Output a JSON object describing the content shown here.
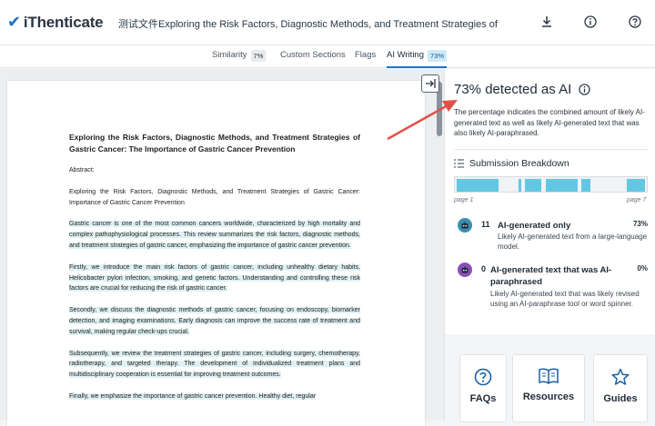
{
  "header": {
    "logo_text": "iThenticate",
    "doc_title": "测试文件Exploring the Risk Factors, Diagnostic Methods, and Treatment Strategies of Gastric Cancer The I",
    "icons": [
      "download-icon",
      "info-icon",
      "help-icon"
    ]
  },
  "tabs": [
    {
      "label": "Similarity",
      "badge": "7%"
    },
    {
      "label": "Custom Sections",
      "badge": ""
    },
    {
      "label": "Flags",
      "badge": ""
    },
    {
      "label": "AI Writing",
      "badge": "73%"
    }
  ],
  "document": {
    "title": "Exploring the Risk Factors, Diagnostic Methods, and Treatment Strategies of Gastric Cancer: The Importance of Gastric Cancer Prevention",
    "abstract_label": "Abstract:",
    "abstract_text": "Exploring the Risk Factors, Diagnostic Methods, and Treatment Strategies of Gastric Cancer: Importance of Gastric Cancer Prevention",
    "paragraphs": [
      "Gastric cancer is one of the most common cancers worldwide, characterized by high mortality and complex pathophysiological processes. This review summarizes the risk factors, diagnostic methods, and treatment strategies of gastric cancer, emphasizing the importance of gastric cancer prevention.",
      "Firstly, we introduce the main risk factors of gastric cancer, including unhealthy dietary habits, Helicobacter pylori infection, smoking, and genetic factors. Understanding and controlling these risk factors are crucial for reducing the risk of gastric cancer.",
      "Secondly, we discuss the diagnostic methods of gastric cancer, focusing on endoscopy, biomarker detection, and imaging examinations. Early diagnosis can improve the success rate of treatment and survival, making regular check-ups crucial.",
      "Subsequently, we review the treatment strategies of gastric cancer, including surgery, chemotherapy, radiotherapy, and targeted therapy. The development of individualized treatment plans and multidisciplinary cooperation is essential for improving treatment outcomes.",
      "Finally, we emphasize the importance of gastric cancer prevention. Healthy diet, regular"
    ]
  },
  "panel": {
    "title": "73% detected as AI",
    "description": "The percentage indicates the combined amount of likely AI-generated text as well as likely AI-generated text that was also likely AI-paraphrased.",
    "breakdown_title": "Submission Breakdown",
    "page_start_label": "page 1",
    "page_end_label": "page 7",
    "items": [
      {
        "count": "11",
        "label": "AI-generated only",
        "pct": "73%",
        "desc": "Likely AI-generated text from a large-language model.",
        "color": "#3a8fb0"
      },
      {
        "count": "0",
        "label": "AI-generated text that was AI-paraphrased",
        "pct": "0%",
        "desc": "Likely AI-generated text that was likely revised using an AI-paraphrase tool or word spinner.",
        "color": "#8a4fb8"
      }
    ]
  },
  "cards": [
    {
      "label": "FAQs",
      "icon": "question-icon"
    },
    {
      "label": "Resources",
      "icon": "book-icon"
    },
    {
      "label": "Guides",
      "icon": "star-icon"
    }
  ],
  "colors": {
    "accent": "#1a73c8",
    "highlight": "#dff1f3",
    "bar_fill": "#62c7e3",
    "arrow": "#e2504a"
  }
}
